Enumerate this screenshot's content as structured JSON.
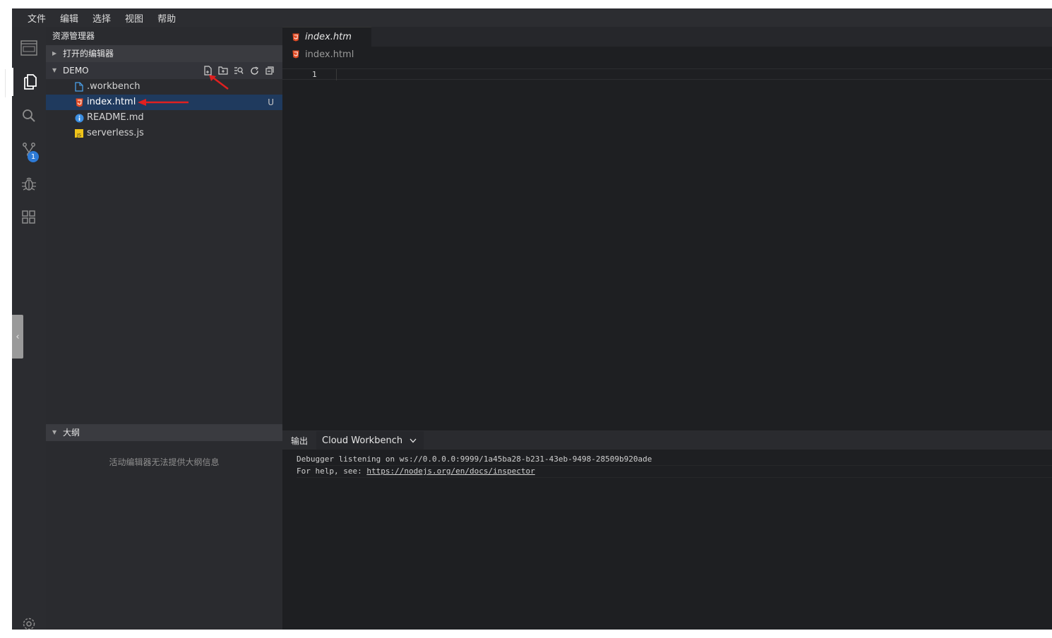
{
  "menu": {
    "items": [
      "文件",
      "编辑",
      "选择",
      "视图",
      "帮助"
    ]
  },
  "activity": {
    "scm_badge": "1"
  },
  "sidebar": {
    "title": "资源管理器",
    "open_editors": "打开的编辑器",
    "folder": "DEMO",
    "files": [
      {
        "name": ".workbench",
        "icon": "file-icon",
        "status": ""
      },
      {
        "name": "index.html",
        "icon": "html-file-icon",
        "status": "U"
      },
      {
        "name": "README.md",
        "icon": "info-file-icon",
        "status": ""
      },
      {
        "name": "serverless.js",
        "icon": "js-file-icon",
        "status": ""
      }
    ],
    "outline": "大纲",
    "outline_message": "活动编辑器无法提供大纲信息"
  },
  "editor": {
    "tab_label": "index.htm",
    "breadcrumb": "index.html",
    "line_number": "1"
  },
  "panel": {
    "title": "输出",
    "channel": "Cloud Workbench",
    "lines": [
      "Debugger listening on ws://0.0.0.0:9999/1a45ba28-b231-43eb-9498-28509b920ade",
      "For help, see: "
    ],
    "link": "https://nodejs.org/en/docs/inspector"
  },
  "colors": {
    "accent": "#2d7ad6",
    "html_icon": "#e44d26",
    "js_icon": "#f0c419",
    "arrow": "#e02020"
  }
}
